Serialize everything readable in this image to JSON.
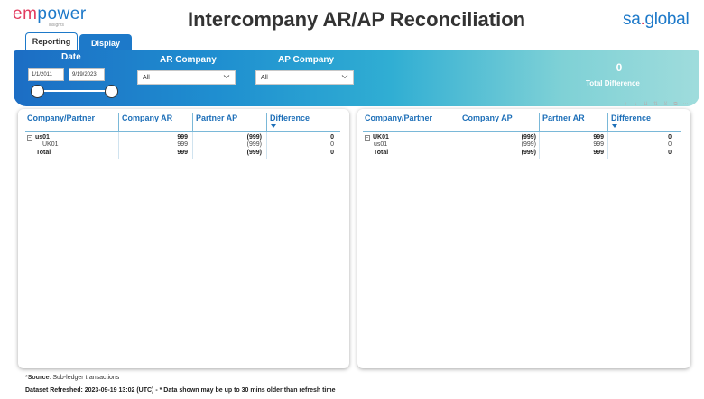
{
  "header": {
    "logo_em": "em",
    "logo_power": "power",
    "logo_tagline": "insights",
    "title": "Intercompany AR/AP Reconciliation",
    "right_logo_a": "sa",
    "right_logo_dot": ".",
    "right_logo_b": "global"
  },
  "tabs": [
    {
      "label": "Reporting"
    },
    {
      "label": "Display"
    }
  ],
  "filters": {
    "date": {
      "label": "Date",
      "start": "1/1/2011",
      "end": "9/19/2023"
    },
    "ar_company": {
      "label": "AR Company",
      "value": "All"
    },
    "ap_company": {
      "label": "AP Company",
      "value": "All"
    }
  },
  "kpi": {
    "value": "0",
    "label": "Total Difference"
  },
  "toolbar_icons": [
    "↑",
    "↓",
    "⇊",
    "⇅",
    "⊻",
    "⧉",
    "⋯"
  ],
  "ar_matrix": {
    "headers": [
      "Company/Partner",
      "Company AR",
      "Partner AP",
      "Difference"
    ],
    "rows": [
      {
        "partner": "us01",
        "a": "999",
        "b": "(999)",
        "diff": "0"
      },
      {
        "partner": "UK01",
        "a": "999",
        "b": "(999)",
        "diff": "0"
      },
      {
        "partner": "Total",
        "a": "999",
        "b": "(999)",
        "diff": "0"
      }
    ]
  },
  "ap_matrix": {
    "headers": [
      "Company/Partner",
      "Company AP",
      "Partner AR",
      "Difference"
    ],
    "rows": [
      {
        "partner": "UK01",
        "a": "(999)",
        "b": "999",
        "diff": "0"
      },
      {
        "partner": "us01",
        "a": "(999)",
        "b": "999",
        "diff": "0"
      },
      {
        "partner": "Total",
        "a": "(999)",
        "b": "999",
        "diff": "0"
      }
    ]
  },
  "footer": {
    "source_prefix": "*",
    "source_label": "Source",
    "source_text": ": Sub-ledger transactions",
    "refreshed": "Dataset Refreshed: 2023-09-19 13:02 (UTC) - * Data shown may be up to 30 mins older than refresh time"
  },
  "colors": {
    "accent": "#1d79c9",
    "header_text": "#1d6fb8",
    "logo_red": "#e23c5f"
  }
}
